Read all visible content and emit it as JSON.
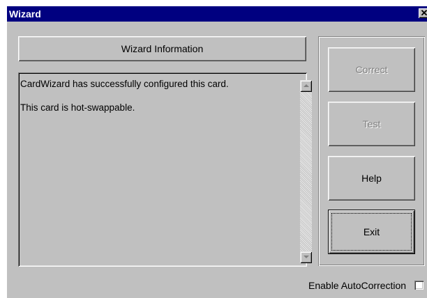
{
  "window": {
    "title": "Wizard",
    "close_glyph": "✕"
  },
  "info_header": {
    "label": "Wizard Information"
  },
  "message_panel": {
    "lines": [
      "CardWizard has successfully configured this card.",
      "This card is hot-swappable."
    ]
  },
  "buttons": {
    "correct": {
      "label": "Correct",
      "enabled": false
    },
    "test": {
      "label": "Test",
      "enabled": false
    },
    "help": {
      "label": "Help",
      "enabled": true
    },
    "exit": {
      "label": "Exit",
      "enabled": true,
      "default": true
    }
  },
  "options": {
    "auto_correction_label": "Enable AutoCorrection",
    "auto_correction_checked": false
  },
  "colors": {
    "titlebar": "#000080",
    "face": "#c0c0c0",
    "disabled_text": "#808080"
  },
  "icons": {
    "close": "close-icon",
    "scroll_up": "chevron-up-icon",
    "scroll_down": "chevron-down-icon"
  }
}
